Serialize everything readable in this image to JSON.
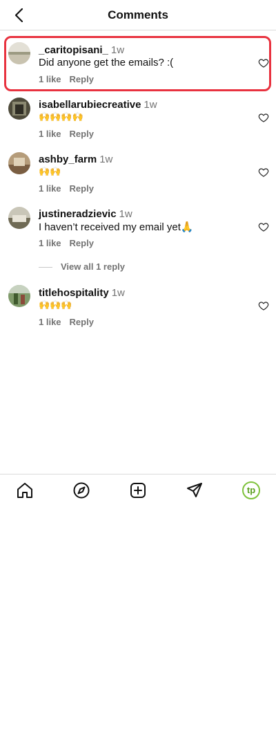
{
  "header": {
    "title": "Comments",
    "back_icon": "chevron-left-icon"
  },
  "comments": [
    {
      "username": "_caritopisani_",
      "time": "1w",
      "text": "Did anyone get the emails? :(",
      "likes": "1 like",
      "reply": "Reply",
      "highlighted": true
    },
    {
      "username": "isabellarubiecreative",
      "time": "1w",
      "text": "🙌🙌🙌🙌",
      "likes": "1 like",
      "reply": "Reply"
    },
    {
      "username": "ashby_farm",
      "time": "1w",
      "text": "🙌🙌",
      "likes": "1 like",
      "reply": "Reply"
    },
    {
      "username": "justineradzievic",
      "time": "1w",
      "text": "I haven’t received my email yet🙏",
      "likes": "1 like",
      "reply": "Reply",
      "view_replies": "View all 1 reply"
    },
    {
      "username": "titlehospitality",
      "time": "1w",
      "text": "🙌🙌🙌",
      "likes": "1 like",
      "reply": "Reply"
    }
  ],
  "highlight_color": "#e8323f",
  "bottom_nav": {
    "items": [
      "home-icon",
      "explore-icon",
      "new-post-icon",
      "direct-message-icon",
      "profile-icon"
    ],
    "profile_initials": "tp",
    "profile_ring_color": "#7ec23b"
  }
}
